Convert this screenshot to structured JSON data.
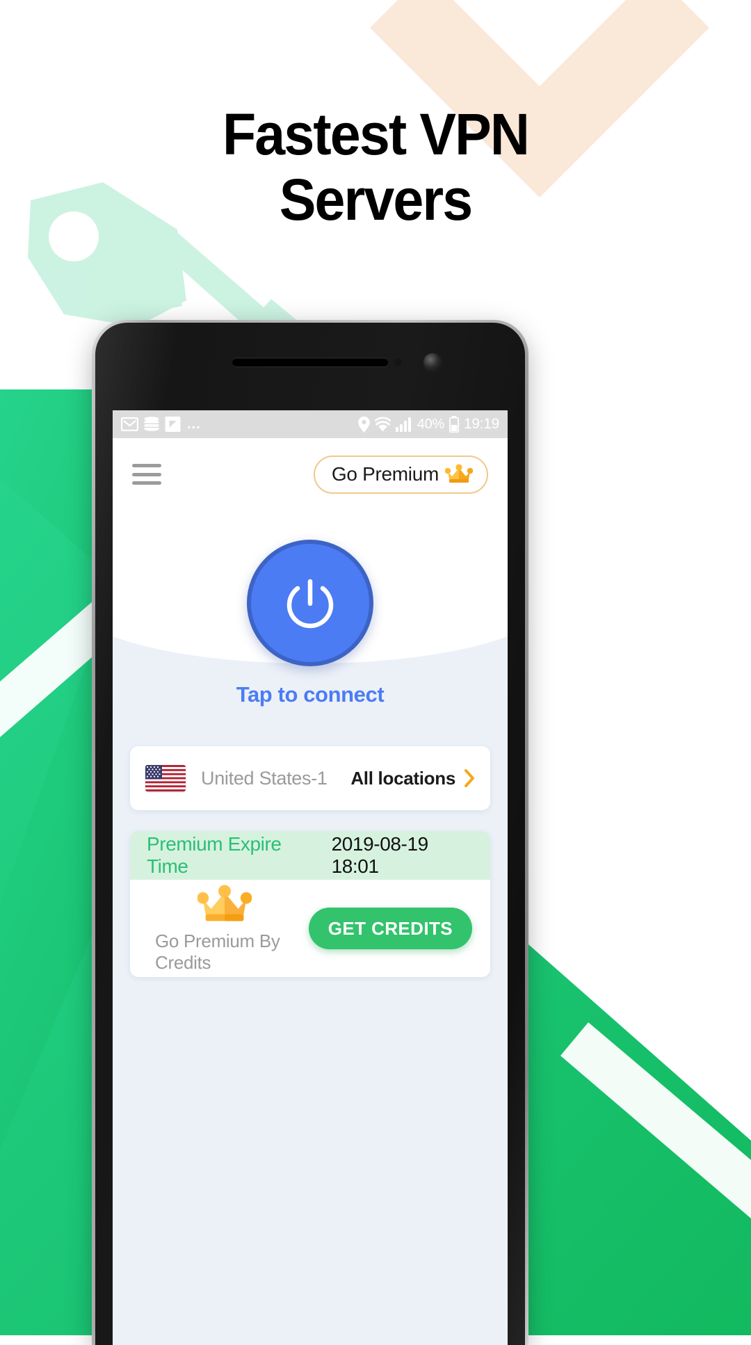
{
  "promo": {
    "headline_line1": "Fastest VPN",
    "headline_line2": "Servers"
  },
  "colors": {
    "brand_green": "#22C07A",
    "accent_blue": "#4C7CF3",
    "premium_gold": "#F0C98A",
    "credits_green": "#32C36C",
    "banner_green": "#D6F2DF",
    "screen_bg": "#ECF1F8"
  },
  "phone": {
    "statusbar": {
      "left_icons": [
        "gmail-icon",
        "database-icon",
        "flipboard-icon"
      ],
      "overflow": "...",
      "right_icons": [
        "location-pin-icon",
        "wifi-icon",
        "cellular-signal-icon",
        "battery-icon"
      ],
      "battery_percent": "40%",
      "time": "19:19"
    },
    "appbar": {
      "menu_icon": "hamburger-menu-icon",
      "premium_label": "Go Premium",
      "premium_icon": "crown-icon"
    },
    "hero": {
      "power_icon": "power-icon",
      "connect_label": "Tap to connect"
    },
    "location_card": {
      "flag_icon": "us-flag-icon",
      "server_name": "United States-1",
      "all_locations_label": "All locations",
      "chevron_icon": "chevron-right-icon"
    },
    "premium_card": {
      "expire_label": "Premium Expire Time",
      "expire_value": "2019-08-19 18:01",
      "crown_icon": "crown-icon",
      "credits_caption": "Go Premium By Credits",
      "credits_button_label": "GET CREDITS"
    }
  }
}
